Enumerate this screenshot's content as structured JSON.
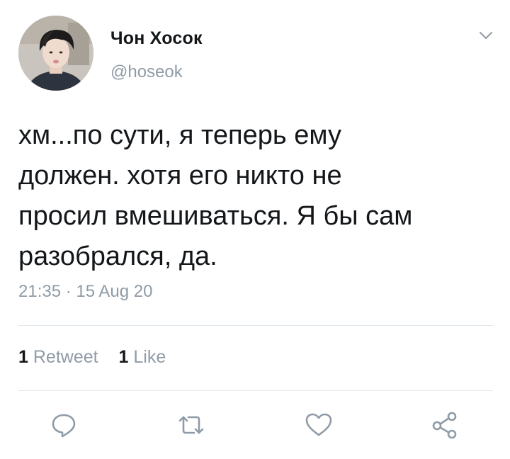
{
  "author": {
    "display_name": "Чон Хосок",
    "handle": "@hoseok",
    "avatar_icon": "profile-photo"
  },
  "tweet": {
    "text_lines": [
      "хм...по сути, я теперь ему",
      "должен. хотя его никто не",
      "просил вмешиваться. Я бы сам",
      "разобрался, да."
    ],
    "timestamp": "21:35 · 15 Aug 20"
  },
  "stats": {
    "retweets_count": "1",
    "retweets_label": "Retweet",
    "likes_count": "1",
    "likes_label": "Like"
  },
  "actions": [
    {
      "icon": "reply-icon"
    },
    {
      "icon": "retweet-icon"
    },
    {
      "icon": "like-icon"
    },
    {
      "icon": "share-icon"
    }
  ],
  "colors": {
    "text": "#14171a",
    "secondary": "#8f9ba6",
    "divider": "#e1e8ed",
    "icon": "#8f9ba6"
  }
}
